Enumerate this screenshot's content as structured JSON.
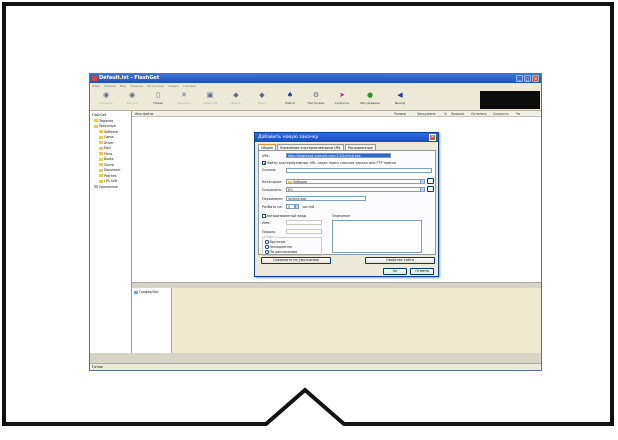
{
  "app": {
    "title": "Default.lst - FlashGet",
    "menu": [
      "Файл",
      "Правка",
      "Вид",
      "Задание",
      "Категория",
      "Сервис",
      "Справка"
    ]
  },
  "toolbar": {
    "buttons": [
      {
        "label": "Открыть",
        "icon": "open-icon"
      },
      {
        "label": "Запуск",
        "icon": "play-icon"
      },
      {
        "label": "Новая",
        "icon": "new-icon"
      },
      {
        "label": "Удалить",
        "icon": "delete-icon"
      },
      {
        "label": "Свойства",
        "icon": "properties-icon"
      },
      {
        "label": "Вверх",
        "icon": "up-icon"
      },
      {
        "label": "Вниз",
        "icon": "down-icon"
      },
      {
        "label": "Найти",
        "icon": "find-icon"
      },
      {
        "label": "Настройки",
        "icon": "settings-icon"
      },
      {
        "label": "Скорость",
        "icon": "speed-icon"
      },
      {
        "label": "Обсуждение",
        "icon": "discussion-icon"
      },
      {
        "label": "Выход",
        "icon": "exit-icon"
      }
    ]
  },
  "tree": {
    "root": "FlashGet",
    "items": [
      {
        "label": "Задания",
        "level": 1
      },
      {
        "label": "Принятые",
        "level": 1
      },
      {
        "label": "Software",
        "level": 2
      },
      {
        "label": "Game",
        "level": 2
      },
      {
        "label": "Driver",
        "level": 2
      },
      {
        "label": "Mp3",
        "level": 2
      },
      {
        "label": "Films",
        "level": 2
      },
      {
        "label": "Books",
        "level": 2
      },
      {
        "label": "Coursi",
        "level": 2
      },
      {
        "label": "Document",
        "level": 2
      },
      {
        "label": "Patches",
        "level": 2
      },
      {
        "label": "LPS Soft",
        "level": 2
      },
      {
        "label": "Удаленные",
        "level": 1
      }
    ]
  },
  "list": {
    "columns": [
      "Имя файла",
      "Размер",
      "Загружено",
      "%",
      "Прошло",
      "Осталось",
      "Скорость",
      "Ча"
    ]
  },
  "bottom": {
    "item": "График/Лог"
  },
  "status": "Готов",
  "dialog": {
    "title": "Добавить новую закачку",
    "tabs": [
      "Общее",
      "Упрвление альтернативными URL",
      "Расширенные"
    ],
    "url_label": "URL:",
    "url_value": "http://download.ulamont.com/1/1/lizhiinit.exe",
    "mirror_text": "Найти альтернативные URL через поиск списков зеркал или FTP поиска",
    "referer_label": "Ссылка:",
    "category_label": "Категория:",
    "category_value": "Software",
    "save_label": "Сохранить:",
    "save_value": "D:\\",
    "rename_label": "Переименн:",
    "rename_value": "lizhiinit.exe",
    "split_label": "Разбить на:",
    "split_value": "5",
    "split_suffix": "частей",
    "login_label": "Авторизованный вход",
    "user_label": "Имя:",
    "pass_label": "Пароль:",
    "start_label": "Старт",
    "start_options": [
      "Вручную",
      "Немедленно",
      "По расписанию"
    ],
    "desc_label": "Описание:",
    "btn_default": "Сохранить по умолчанию",
    "btn_site": "Свойства сайта",
    "btn_ok": "Ок",
    "btn_cancel": "Отмена"
  }
}
